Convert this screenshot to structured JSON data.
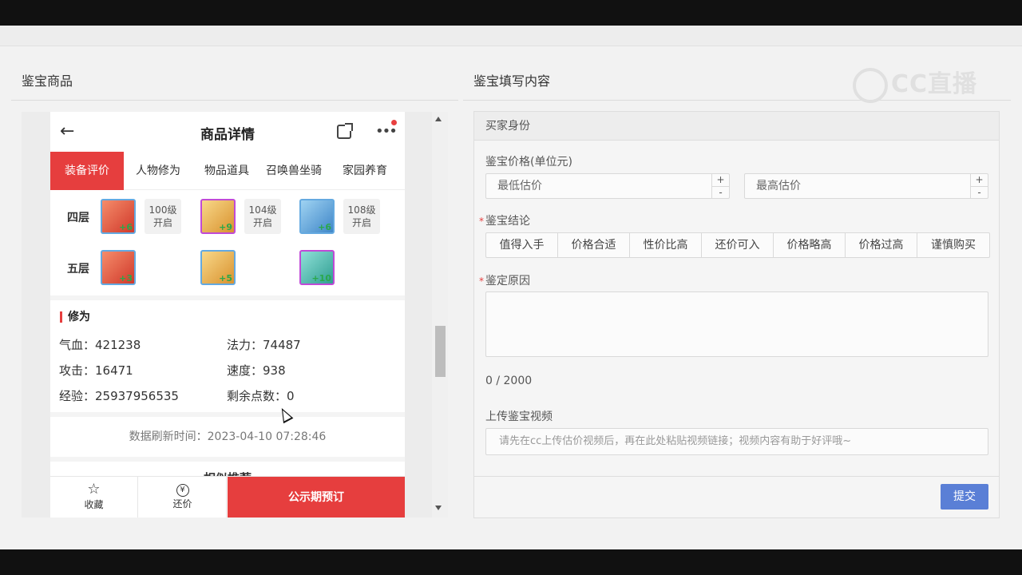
{
  "left_section": {
    "title": "鉴宝商品"
  },
  "right_section": {
    "title": "鉴宝填写内容"
  },
  "watermark": {
    "text": "CC直播"
  },
  "phone": {
    "back_icon": "arrow-left-icon",
    "title": "商品详情",
    "tabs": [
      {
        "label": "装备评价",
        "active": true
      },
      {
        "label": "人物修为",
        "active": false
      },
      {
        "label": "物品道具",
        "active": false
      },
      {
        "label": "召唤兽坐骑",
        "active": false
      },
      {
        "label": "家园养育",
        "active": false
      }
    ],
    "layers": [
      {
        "label": "四层",
        "items": [
          {
            "level": "+6"
          },
          {
            "level": "+9"
          },
          {
            "level": "+6"
          }
        ],
        "locks": [
          {
            "level": "100级",
            "text": "开启"
          },
          {
            "level": "104级",
            "text": "开启"
          },
          {
            "level": "108级",
            "text": "开启"
          }
        ]
      },
      {
        "label": "五层",
        "items": [
          {
            "level": "+3"
          },
          {
            "level": "+5"
          },
          {
            "level": "+10"
          }
        ]
      }
    ],
    "xiuwei": {
      "title": "修为",
      "hp": "气血：421238",
      "mp": "法力：74487",
      "atk": "攻击：16471",
      "spd": "速度：938",
      "exp": "经验：25937956535",
      "points": "剩余点数：0"
    },
    "refresh": "数据刷新时间：2023-04-10 07:28:46",
    "similar": "相似推荐",
    "bottom": {
      "favorite": "收藏",
      "counter_offer": "还价",
      "reserve": "公示期预订"
    }
  },
  "form": {
    "buyer_identity": "买家身份",
    "price_label": "鉴宝价格(单位元)",
    "min_placeholder": "最低估价",
    "max_placeholder": "最高估价",
    "conclusion_label": "鉴宝结论",
    "conclusions": [
      "值得入手",
      "价格合适",
      "性价比高",
      "还价可入",
      "价格略高",
      "价格过高",
      "谨慎购买"
    ],
    "reason_label": "鉴定原因",
    "counter": "0 / 2000",
    "video_label": "上传鉴宝视频",
    "video_placeholder": "请先在cc上传估价视频后，再在此处粘贴视频链接；视频内容有助于好评哦~",
    "submit": "提交"
  }
}
